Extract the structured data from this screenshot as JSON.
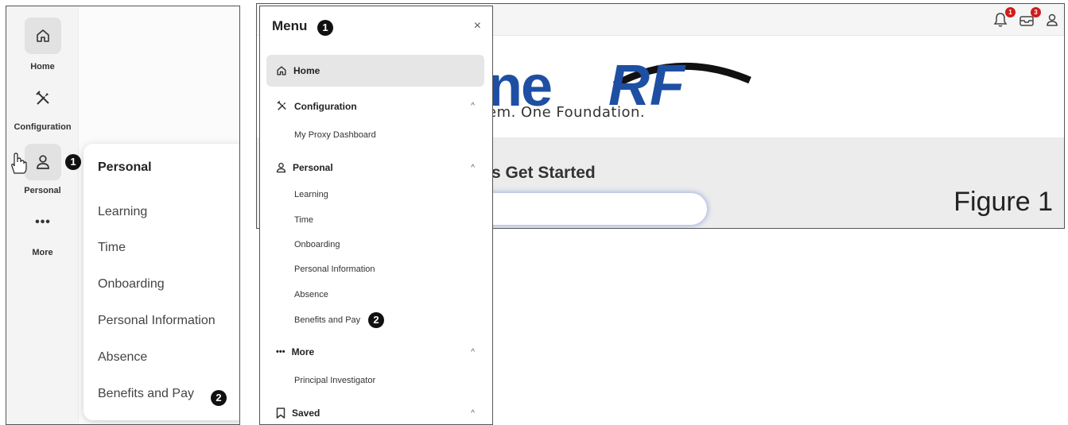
{
  "header": {
    "notification_badge": "1",
    "inbox_badge": "3"
  },
  "logo": {
    "letters": "ne",
    "rf": "RF",
    "tagline": "em. One Foundation."
  },
  "hero": {
    "heading": "'s Get Started"
  },
  "figure_label": "Figure 1",
  "rail": {
    "items": [
      {
        "label": "Home",
        "icon": "home-icon"
      },
      {
        "label": "Configuration",
        "icon": "tools-icon"
      },
      {
        "label": "Personal",
        "icon": "person-icon"
      },
      {
        "label": "More",
        "icon": "more-dots-icon"
      }
    ],
    "callout_1": "1",
    "icon_more": "•••"
  },
  "flyout": {
    "title": "Personal",
    "items": [
      "Learning",
      "Time",
      "Onboarding",
      "Personal Information",
      "Absence",
      "Benefits and Pay"
    ],
    "callout_2": "2"
  },
  "menu": {
    "title": "Menu",
    "callout_1": "1",
    "close_icon": "×",
    "home_label": "Home",
    "sections": [
      {
        "label": "Configuration",
        "items": [
          "My Proxy Dashboard"
        ]
      },
      {
        "label": "Personal",
        "items": [
          "Learning",
          "Time",
          "Onboarding",
          "Personal Information",
          "Absence",
          "Benefits and Pay"
        ]
      },
      {
        "label": "More",
        "items": [
          "Principal Investigator"
        ]
      },
      {
        "label": "Saved",
        "items": []
      }
    ],
    "chevron": "^",
    "callout_2": "2",
    "more_dots": "•••"
  }
}
